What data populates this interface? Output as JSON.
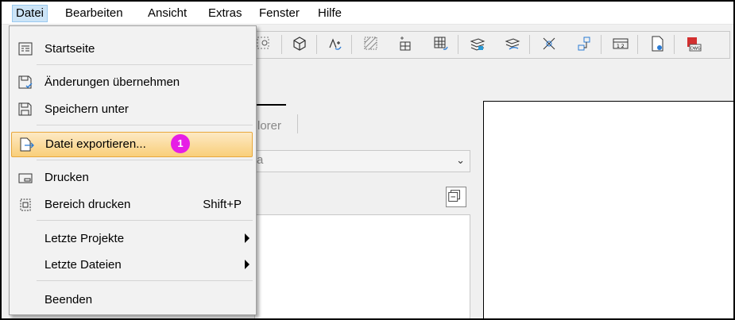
{
  "menubar": {
    "items": [
      {
        "label": "Datei"
      },
      {
        "label": "Bearbeiten"
      },
      {
        "label": "Ansicht"
      },
      {
        "label": "Extras"
      },
      {
        "label": "Fenster"
      },
      {
        "label": "Hilfe"
      }
    ]
  },
  "file_menu": {
    "items": [
      {
        "label": "Startseite",
        "icon": "home-page-icon"
      },
      {
        "label": "Änderungen übernehmen",
        "icon": "save-changes-icon"
      },
      {
        "label": "Speichern unter",
        "icon": "save-as-icon"
      },
      {
        "label": "Datei exportieren...",
        "icon": "export-file-icon"
      },
      {
        "label": "Drucken",
        "icon": "print-icon"
      },
      {
        "label": "Bereich drucken",
        "shortcut": "Shift+P",
        "icon": "print-area-icon"
      },
      {
        "label": "Letzte Projekte",
        "submenu": true
      },
      {
        "label": "Letzte Dateien",
        "submenu": true
      },
      {
        "label": "Beenden"
      }
    ]
  },
  "annotation": {
    "badge": "1"
  },
  "panel": {
    "tab_fragment": "lorer",
    "dropdown_fragment": "a"
  },
  "colors": {
    "highlight": "#f9cf7a",
    "badge": "#e61ee6",
    "menubar_active": "#cce4f7"
  }
}
